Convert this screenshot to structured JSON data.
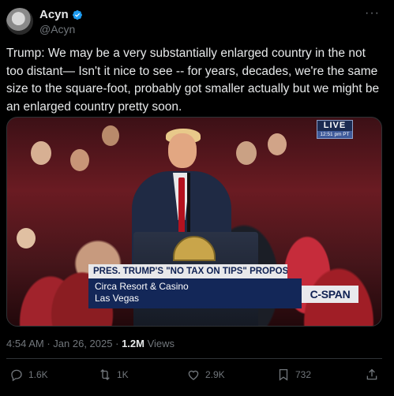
{
  "author": {
    "name": "Acyn",
    "handle": "@Acyn",
    "verified": true,
    "avatar_icon": "avatar-image"
  },
  "tweet": {
    "text": "Trump: We may be a very substantially enlarged country in the not too distant— Isn't it nice to see -- for years, decades, we're the same size to the square-foot, probably got smaller actually but we might be an enlarged country pretty soon."
  },
  "media": {
    "live_label": "LIVE",
    "live_time": "12:51 pm PT",
    "chyron": "PRES. TRUMP'S \"NO TAX ON TIPS\" PROPOSAL",
    "location_line1": "Circa Resort & Casino",
    "location_line2": "Las Vegas",
    "network": "C-SPAN"
  },
  "meta": {
    "time": "4:54 AM",
    "separator": "·",
    "date": "Jan 26, 2025",
    "views_count": "1.2M",
    "views_label": "Views"
  },
  "actions": {
    "replies": "1.6K",
    "reposts": "1K",
    "likes": "2.9K",
    "bookmarks": "732"
  },
  "colors": {
    "background": "#000000",
    "text": "#e7e9ea",
    "muted": "#71767b",
    "verified": "#1d9bf0",
    "divider": "#2f3336"
  }
}
